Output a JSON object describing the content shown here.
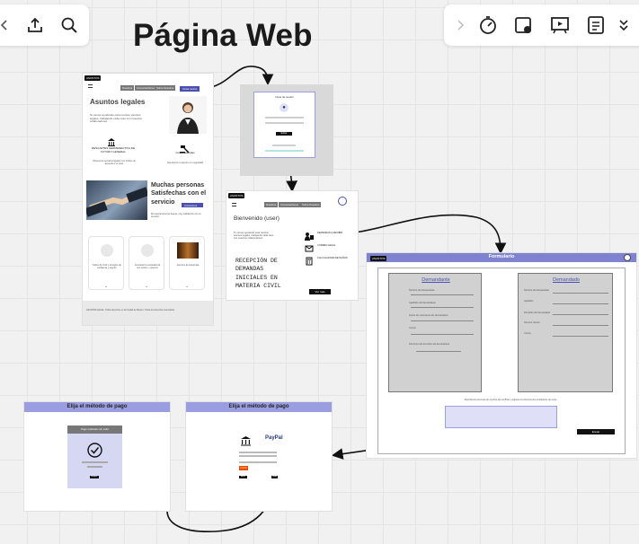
{
  "toolbar_left": {
    "icons": [
      "chevron-left-icon",
      "upload-icon",
      "search-icon"
    ]
  },
  "toolbar_right": {
    "icons": [
      "chevron-right-icon",
      "timer-icon",
      "card-icon",
      "present-icon",
      "notes-icon",
      "chevron-down-icon"
    ]
  },
  "board_title": "Página Web",
  "landing": {
    "logo": "ASUNTOS",
    "nav": [
      "Nosotros",
      "Conversaciones",
      "Sobre Nosotros"
    ],
    "nav_button": "Iniciar sesión",
    "heading": "Asuntos legales",
    "intro": "Te vamos ayudando para resolver asuntos legales, trabajando cada caso con nuestros colaboradores.",
    "icon1_label": "DESCARTES HERMENEUTICA DE FUTURO GENERAL",
    "icon2_label": "Civiles adeudas",
    "icon1_sub": "Ofrecemos servicios ligados con Civiles de acuerdo a su caso",
    "icon2_sub": "Atendemos tu asunto a tu seguridad",
    "heading2": "Muchas personas Satisfechas con el servicio",
    "heading2_button": "Conócenos",
    "heading2_text": "Mi experiencia fue buena, muy satisfecho con el servicio.",
    "cards": [
      "Sobre de Civil y Arreglos de problema y seguro",
      "Consultar la sociedad de sus casos y seguros",
      "Asuntos de Hacienda"
    ],
    "footer": "ASUNTOS LEGAL. Todos derechos en la Ciudad de México. Todos los derechos reservados"
  },
  "login": {
    "title": "Inicio de sesión",
    "button": "Entrar"
  },
  "dashboard": {
    "logo": "ASUNTOS",
    "nav": [
      "Nosotros",
      "Conversaciones",
      "Sobre Nosotros"
    ],
    "welcome": "Bienvenido (user)",
    "intro": "Te vamos ayudando para resolver asuntos legales, trabajando cada caso con nuestros colaboradores.",
    "menu": [
      "DEMANDAS A RECIBIR",
      "CORREO LEGAL",
      "CALCULADORA DE DAÑOS"
    ],
    "reception": "RECEPCIÓN DE DEMANDAS INICIALES EN MATERIA CIVIL",
    "button": "Ver más"
  },
  "form": {
    "logo": "ASUNTOS",
    "title": "Formulario",
    "left_title": "Demandante",
    "right_title": "Demandado",
    "left_fields": [
      "Nombre del demandante",
      "Apellidos del demandante",
      "Fecha de nacimiento del demandante",
      "Correo",
      "Dirección del domicilio del demandante"
    ],
    "right_fields": [
      "Nombre del demandado",
      "Apellidos",
      "Domicilio del demandado",
      "Número celular",
      "Correo"
    ],
    "note": "Describa brevemente los hechos del conflicto y adjunte los documentos probatorios del caso",
    "button": "Enviar"
  },
  "pay1": {
    "title": "Elija el método de pago",
    "card_title": "Pago realizado con éxito",
    "card_button": "Aceptar"
  },
  "pay2": {
    "title": "Elija el método de pago",
    "paypal": "PayPal",
    "oxxo": "OXXO",
    "btn_left": "Atrás",
    "btn_right": "Pagar"
  },
  "colors": {
    "accent": "#4a4fb0",
    "module_header": "#9a9ee0",
    "canvas": "#f1f1f1"
  }
}
